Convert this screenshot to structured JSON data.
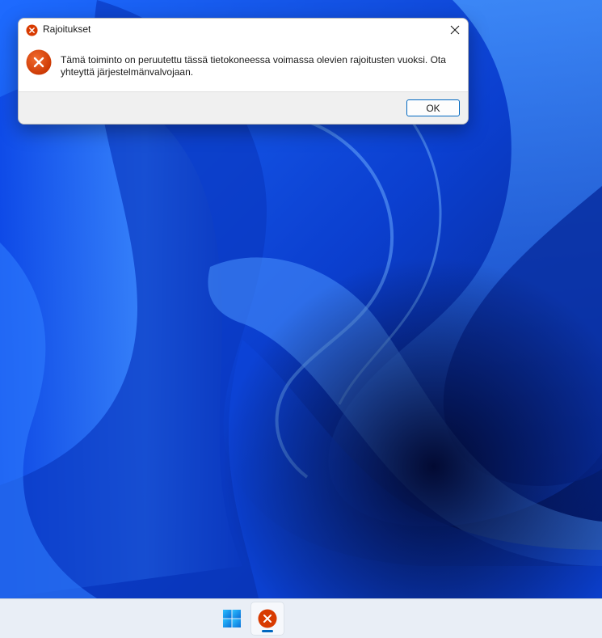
{
  "dialog": {
    "title": "Rajoitukset",
    "message": "Tämä toiminto on peruutettu tässä tietokoneessa voimassa olevien rajoitusten vuoksi. Ota yhteyttä järjestelmänvalvojaan.",
    "ok_label": "OK",
    "title_icon": "error-icon",
    "close_icon": "close-icon"
  },
  "taskbar": {
    "items": [
      {
        "name": "start",
        "icon": "windows-logo-icon"
      },
      {
        "name": "restrictions-dialog",
        "icon": "error-icon",
        "active": true
      }
    ]
  },
  "colors": {
    "error_red": "#d83b01",
    "accent": "#0067c0",
    "wallpaper_blue": "#0a3fc7"
  }
}
